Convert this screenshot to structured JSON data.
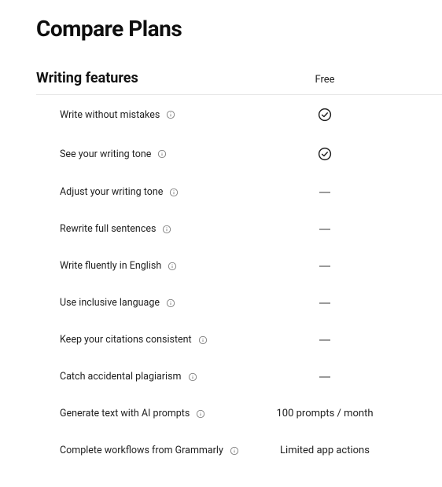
{
  "title": "Compare Plans",
  "section_title": "Writing features",
  "plan_label": "Free",
  "features": [
    {
      "label": "Write without mistakes",
      "value_type": "check"
    },
    {
      "label": "See your writing tone",
      "value_type": "check"
    },
    {
      "label": "Adjust your writing tone",
      "value_type": "dash"
    },
    {
      "label": "Rewrite full sentences",
      "value_type": "dash"
    },
    {
      "label": "Write fluently in English",
      "value_type": "dash"
    },
    {
      "label": "Use inclusive language",
      "value_type": "dash"
    },
    {
      "label": "Keep your citations consistent",
      "value_type": "dash"
    },
    {
      "label": "Catch accidental plagiarism",
      "value_type": "dash"
    },
    {
      "label": "Generate text with AI prompts",
      "value_type": "text",
      "value_text": "100 prompts / month"
    },
    {
      "label": "Complete workflows from Grammarly",
      "value_type": "text",
      "value_text": "Limited app actions"
    }
  ]
}
